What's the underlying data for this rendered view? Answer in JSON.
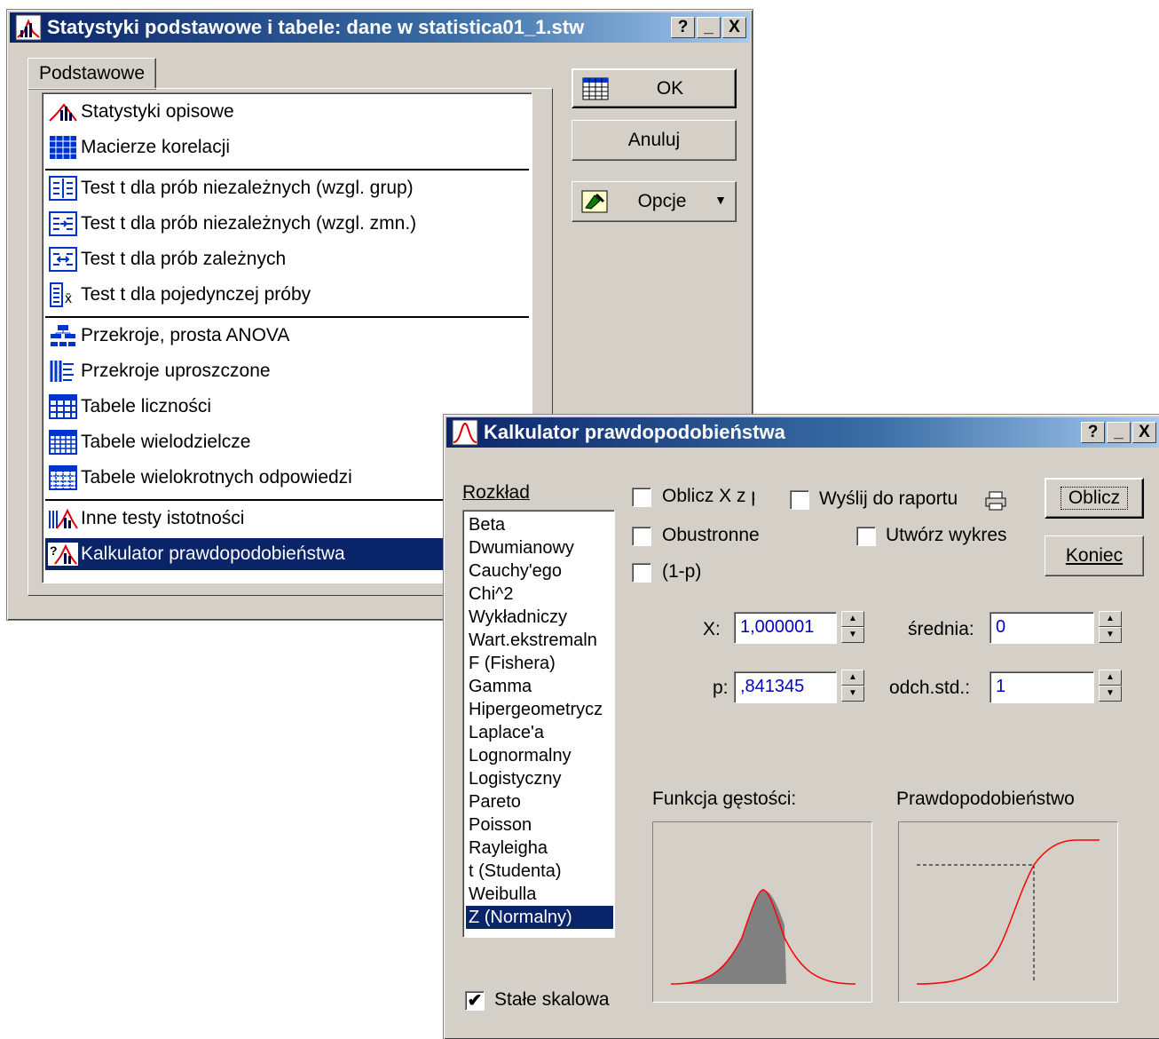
{
  "main_window": {
    "title": "Statystyki podstawowe i tabele: dane w statistica01_1.stw",
    "help_btn": "?",
    "min_btn": "_",
    "close_btn": "X",
    "tab_label": "Podstawowe",
    "ok_label": "OK",
    "cancel_label": "Anuluj",
    "options_label": "Opcje",
    "items": [
      {
        "label": "Statystyki opisowe",
        "icon": "descriptive-stats-icon"
      },
      {
        "label": "Macierze korelacji",
        "icon": "correlation-matrix-icon"
      },
      {
        "label": "Test t dla prób niezależnych (wzgl. grup)",
        "icon": "t-test-groups-icon"
      },
      {
        "label": "Test t dla prób niezależnych (wzgl. zmn.)",
        "icon": "t-test-variables-icon"
      },
      {
        "label": "Test t dla prób zależnych",
        "icon": "t-test-dependent-icon"
      },
      {
        "label": "Test t dla pojedynczej próby",
        "icon": "t-test-single-icon"
      },
      {
        "label": "Przekroje, prosta ANOVA",
        "icon": "anova-icon"
      },
      {
        "label": "Przekroje uproszczone",
        "icon": "breakdown-icon"
      },
      {
        "label": "Tabele liczności",
        "icon": "frequency-table-icon"
      },
      {
        "label": "Tabele wielodzielcze",
        "icon": "crosstab-icon"
      },
      {
        "label": "Tabele wielokrotnych odpowiedzi",
        "icon": "multiple-response-icon"
      },
      {
        "label": "Inne testy istotności",
        "icon": "other-tests-icon"
      },
      {
        "label": "Kalkulator prawdopodobieństwa",
        "icon": "probability-calculator-icon"
      }
    ]
  },
  "calc_window": {
    "title": "Kalkulator prawdopodobieństwa",
    "help_btn": "?",
    "min_btn": "_",
    "close_btn": "X",
    "distribution_label": "Rozkład",
    "distributions": [
      "Beta",
      "Dwumianowy",
      "Cauchy'ego",
      "Chi^2",
      "Wykładniczy",
      "Wart.ekstremaln",
      "F (Fishera)",
      "Gamma",
      "Hipergeometrycz",
      "Laplace'a",
      "Lognormalny",
      "Logistyczny",
      "Pareto",
      "Poisson",
      "Rayleigha",
      "t (Studenta)",
      "Weibulla",
      "Z (Normalny)"
    ],
    "selected_distribution": "Z (Normalny)",
    "chk_compute_x": "Oblicz X z p",
    "chk_send_report": "Wyślij do raportu",
    "chk_two_sided": "Obustronne",
    "chk_create_graph": "Utwórz wykres",
    "chk_one_minus_p": "(1-p)",
    "compute_btn": "Oblicz",
    "end_btn": "Koniec",
    "x_label": "X:",
    "x_value": "1,000001",
    "p_label": "p:",
    "p_value": ",841345",
    "mean_label": "średnia:",
    "mean_value": "0",
    "sd_label": "odch.std.:",
    "sd_value": "1",
    "density_title": "Funkcja gęstości:",
    "prob_title": "Prawdopodobieństwo",
    "fixed_scale_label": "Stałe skalowa",
    "fixed_scale_checked": "✔"
  },
  "colors": {
    "title_start": "#0a246a",
    "title_end": "#a6caf0",
    "selection": "#0a246a",
    "curve": "#ff0000",
    "value_text": "#0000cc"
  }
}
